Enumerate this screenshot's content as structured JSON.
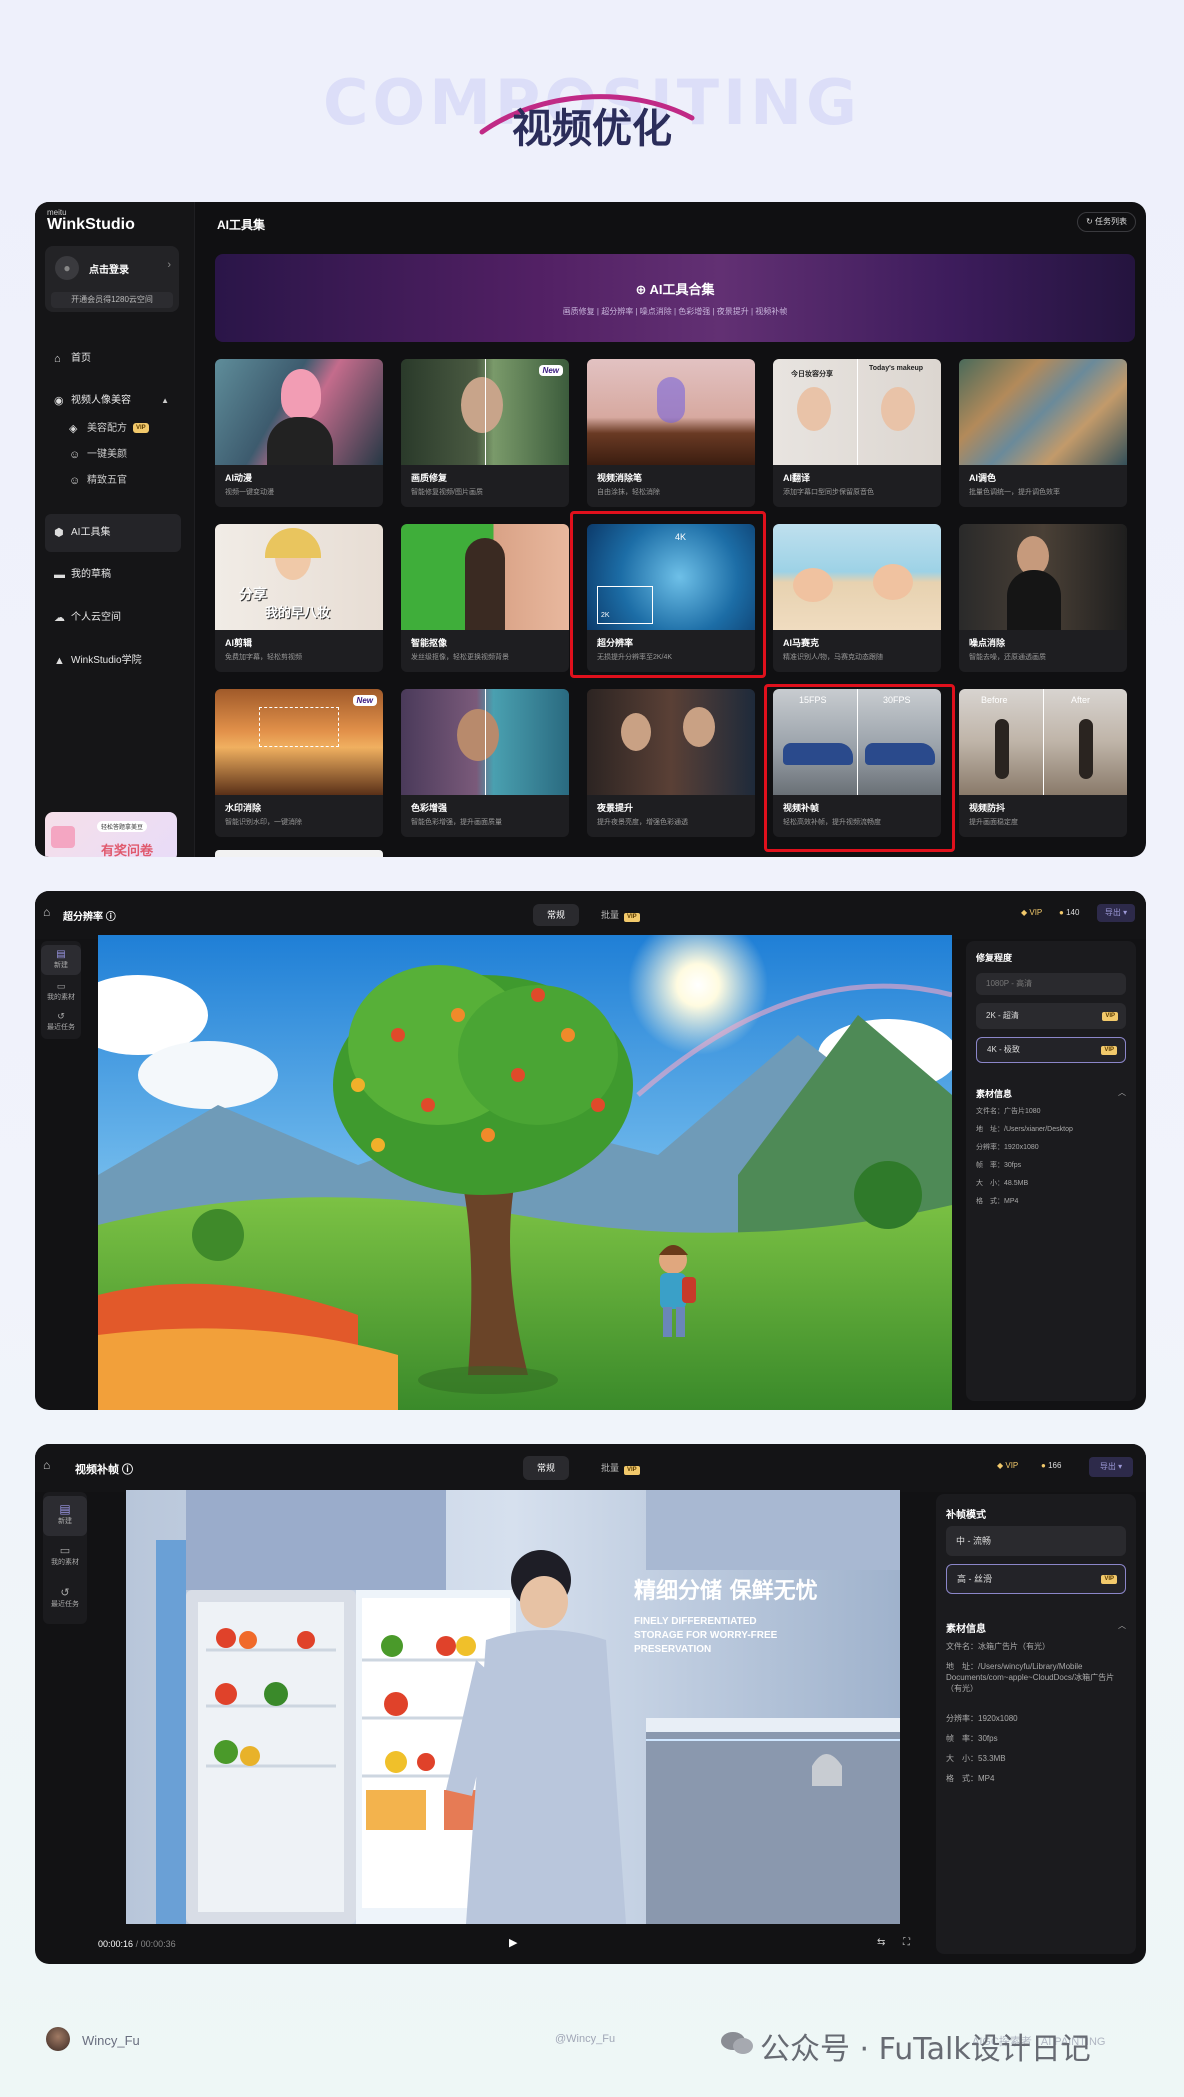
{
  "header": {
    "bg_word": "COMPOSITING",
    "title": "视频优化"
  },
  "panel1": {
    "brand_small": "meitu",
    "brand": "WinkStudio",
    "login_label": "点击登录",
    "vip_tip": "开通会员得1280云空间",
    "nav": [
      {
        "label": "首页",
        "icon": "home-icon"
      },
      {
        "label": "视频人像美容",
        "icon": "portrait-icon"
      },
      {
        "label": "美容配方",
        "icon": "layers-icon",
        "tag": "VIP"
      },
      {
        "label": "一键美颜",
        "icon": "face-icon"
      },
      {
        "label": "精致五官",
        "icon": "features-icon"
      },
      {
        "label": "AI工具集",
        "icon": "cube-icon"
      },
      {
        "label": "我的草稿",
        "icon": "folder-icon"
      },
      {
        "label": "个人云空间",
        "icon": "cloud-icon"
      },
      {
        "label": "WinkStudio学院",
        "icon": "academy-icon"
      }
    ],
    "promo_badge": "轻松答题拿美豆",
    "promo_text": "有奖问卷",
    "title": "AI工具集",
    "task_list": "任务列表",
    "banner_title": "AI工具合集",
    "banner_sub": "画质修复 | 超分辨率 | 噪点消除 | 色彩增强 | 夜景提升 | 视频补帧",
    "cards": [
      {
        "name": "AI动漫",
        "desc": "视频一键变动漫",
        "new": ""
      },
      {
        "name": "画质修复",
        "desc": "智能修复视频/图片画质",
        "new": "New"
      },
      {
        "name": "视频消除笔",
        "desc": "自由涂抹，轻松消除",
        "new": ""
      },
      {
        "name": "AI翻译",
        "desc": "添加字幕口型同步保留原音色",
        "new": ""
      },
      {
        "name": "AI调色",
        "desc": "批量色调统一，提升调色效率",
        "new": ""
      },
      {
        "name": "AI剪辑",
        "desc": "免费加字幕，轻松剪视频",
        "new": ""
      },
      {
        "name": "智能抠像",
        "desc": "发丝级抠像，轻松更换视频背景",
        "new": ""
      },
      {
        "name": "超分辨率",
        "desc": "无损提升分辨率至2K/4K",
        "new": ""
      },
      {
        "name": "AI马赛克",
        "desc": "精准识别人/物，马赛克动态跟随",
        "new": ""
      },
      {
        "name": "噪点消除",
        "desc": "智能去噪，还原通透画质",
        "new": ""
      },
      {
        "name": "水印消除",
        "desc": "智能识别水印，一键消除",
        "new": "New"
      },
      {
        "name": "色彩增强",
        "desc": "智能色彩增强，提升画面质量",
        "new": ""
      },
      {
        "name": "夜景提升",
        "desc": "提升夜景亮度，增强色彩通透",
        "new": ""
      },
      {
        "name": "视频补帧",
        "desc": "轻松高效补帧，提升视频流畅度",
        "new": ""
      },
      {
        "name": "视频防抖",
        "desc": "提升画面稳定度",
        "new": ""
      }
    ],
    "thumb_text": {
      "caption1": "分享",
      "caption2": "我的早八妆",
      "four_k": "4K",
      "two_k": "2K",
      "fps_left": "15FPS",
      "fps_right": "30FPS",
      "before": "Before",
      "after": "After",
      "today_makeup": "Today's makeup",
      "cn_makeup": "今日妆容分享"
    }
  },
  "panel2": {
    "title": "超分辨率",
    "tabs": [
      "常规",
      "批量"
    ],
    "vip": "VIP",
    "coins": "140",
    "export": "导出",
    "left_nav": [
      "新建",
      "我的素材",
      "最近任务"
    ],
    "repair_title": "修复程度",
    "options": [
      "1080P - 高清",
      "2K - 超清",
      "4K - 极致"
    ],
    "info_title": "素材信息",
    "info": [
      "文件名：广告片1080",
      "地　址：/Users/xianer/Desktop",
      "分辨率：1920x1080",
      "帧　率：30fps",
      "大　小：48.5MB",
      "格　式：MP4"
    ]
  },
  "panel3": {
    "title": "视频补帧",
    "tabs": [
      "常规",
      "批量"
    ],
    "vip": "VIP",
    "coins": "166",
    "export": "导出",
    "left_nav": [
      "新建",
      "我的素材",
      "最近任务"
    ],
    "mode_title": "补帧模式",
    "options": [
      "中 - 流畅",
      "高 - 丝滑"
    ],
    "info_title": "素材信息",
    "info_name": "文件名：冰箱广告片（有光）",
    "info_path": "地　址：/Users/wincyfu/Library/Mobile Documents/com~apple~CloudDocs/冰箱广告片（有光）",
    "info": [
      "分辨率：1920x1080",
      "帧　率：30fps",
      "大　小：53.3MB",
      "格　式：MP4"
    ],
    "time_cur": "00:00:16",
    "time_total": "/ 00:00:36",
    "ad_cn": "精细分储  保鲜无忧",
    "ad_en1": "FINELY DIFFERENTIATED",
    "ad_en2": "STORAGE FOR WORRY-FREE",
    "ad_en3": "PRESERVATION"
  },
  "footer": {
    "name": "Wincy_Fu",
    "handle": "@Wincy_Fu",
    "right": "AIGC探索者 | AI PAINTING",
    "watermark": "公众号 · FuTalk设计日记"
  }
}
